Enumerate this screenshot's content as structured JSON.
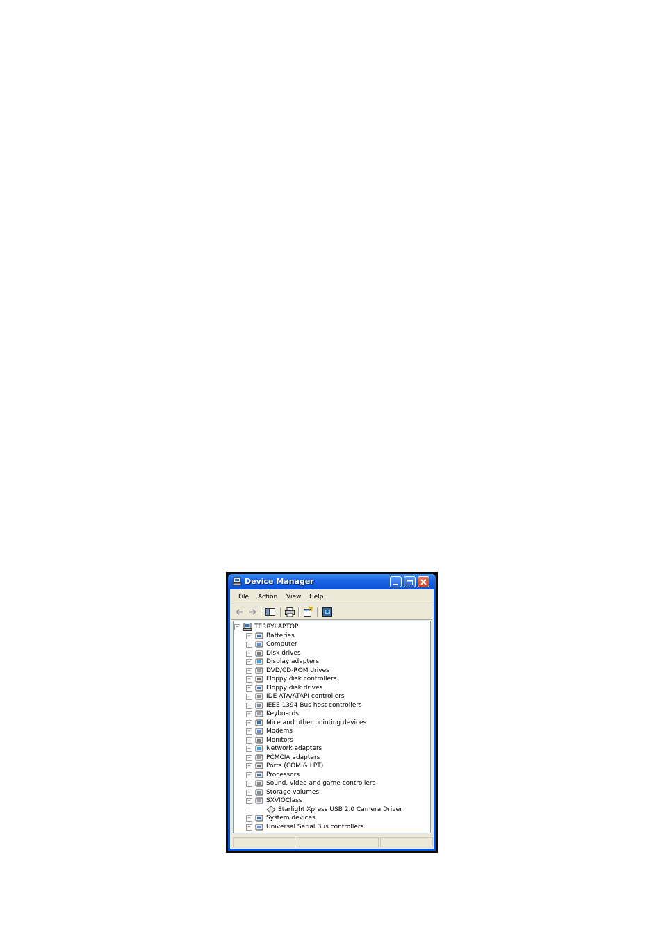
{
  "window": {
    "title": "Device Manager"
  },
  "menu": [
    "File",
    "Action",
    "View",
    "Help"
  ],
  "toolbar": {
    "icons": [
      "back-arrow-icon",
      "forward-arrow-icon",
      "show-hide-tree-icon",
      "print-icon",
      "properties-icon",
      "help-icon"
    ]
  },
  "tree": {
    "root": "TERRYLAPTOP",
    "items": [
      {
        "label": "Batteries",
        "icon": "battery-icon",
        "expanded": false
      },
      {
        "label": "Computer",
        "icon": "computer-icon",
        "expanded": false
      },
      {
        "label": "Disk drives",
        "icon": "disk-drive-icon",
        "expanded": false
      },
      {
        "label": "Display adapters",
        "icon": "display-icon",
        "expanded": false
      },
      {
        "label": "DVD/CD-ROM drives",
        "icon": "cdrom-icon",
        "expanded": false
      },
      {
        "label": "Floppy disk controllers",
        "icon": "floppy-controller-icon",
        "expanded": false
      },
      {
        "label": "Floppy disk drives",
        "icon": "floppy-drive-icon",
        "expanded": false
      },
      {
        "label": "IDE ATA/ATAPI controllers",
        "icon": "ide-controller-icon",
        "expanded": false
      },
      {
        "label": "IEEE 1394 Bus host controllers",
        "icon": "ieee1394-icon",
        "expanded": false
      },
      {
        "label": "Keyboards",
        "icon": "keyboard-icon",
        "expanded": false
      },
      {
        "label": "Mice and other pointing devices",
        "icon": "mouse-icon",
        "expanded": false
      },
      {
        "label": "Modems",
        "icon": "modem-icon",
        "expanded": false
      },
      {
        "label": "Monitors",
        "icon": "monitor-icon",
        "expanded": false
      },
      {
        "label": "Network adapters",
        "icon": "network-adapter-icon",
        "expanded": false
      },
      {
        "label": "PCMCIA adapters",
        "icon": "pcmcia-icon",
        "expanded": false
      },
      {
        "label": "Ports (COM & LPT)",
        "icon": "port-icon",
        "expanded": false
      },
      {
        "label": "Processors",
        "icon": "processor-icon",
        "expanded": false
      },
      {
        "label": "Sound, video and game controllers",
        "icon": "sound-icon",
        "expanded": false
      },
      {
        "label": "Storage volumes",
        "icon": "storage-volume-icon",
        "expanded": false
      },
      {
        "label": "SXVIOClass",
        "icon": "device-class-icon",
        "expanded": true,
        "children": [
          {
            "label": "Starlight Xpress USB 2.0 Camera Driver",
            "icon": "device-icon"
          }
        ]
      },
      {
        "label": "System devices",
        "icon": "system-device-icon",
        "expanded": false
      },
      {
        "label": "Universal Serial Bus controllers",
        "icon": "usb-icon",
        "expanded": false
      }
    ]
  },
  "colors": {
    "titlebar": "#0d50d6",
    "chrome": "#ece9d8",
    "close_button": "#c8401e"
  }
}
